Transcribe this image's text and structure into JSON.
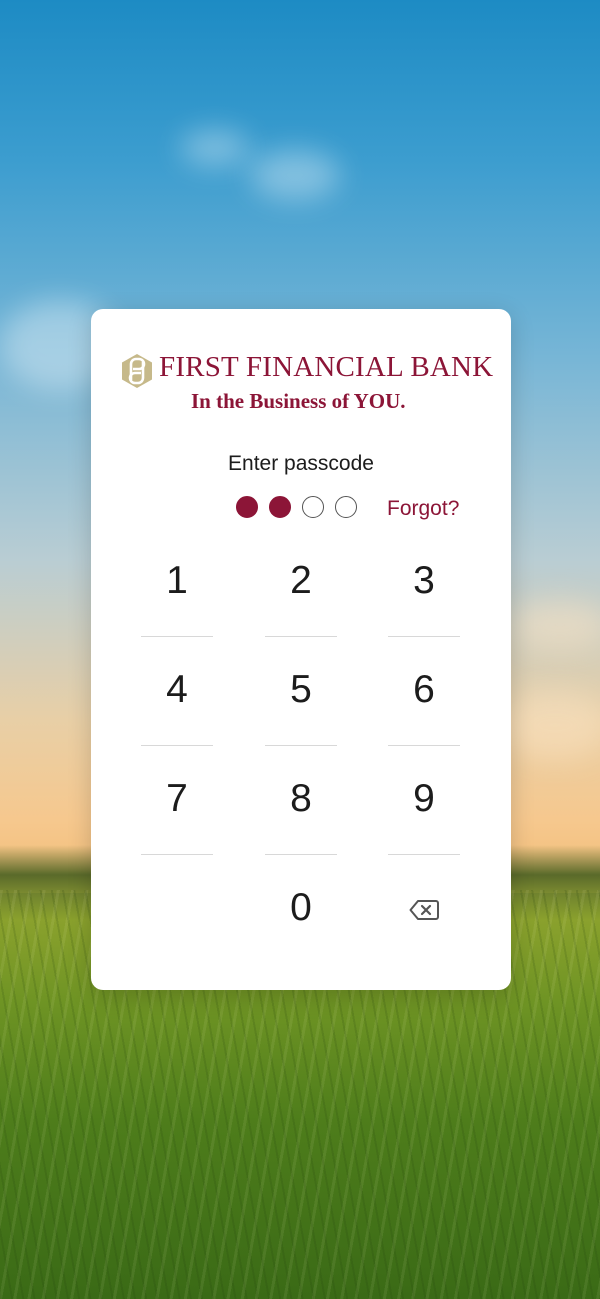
{
  "brand": {
    "name": "FIRST FINANCIAL BANK",
    "tagline": "In the Business of YOU.",
    "primary_color": "#8c1537",
    "logo_mark_color": "#c6b98a"
  },
  "passcode": {
    "prompt": "Enter passcode",
    "length": 4,
    "entered": 2,
    "forgot_label": "Forgot?"
  },
  "keypad": {
    "keys": [
      "1",
      "2",
      "3",
      "4",
      "5",
      "6",
      "7",
      "8",
      "9",
      "",
      "0",
      "backspace"
    ],
    "backspace_icon": "backspace-icon"
  }
}
